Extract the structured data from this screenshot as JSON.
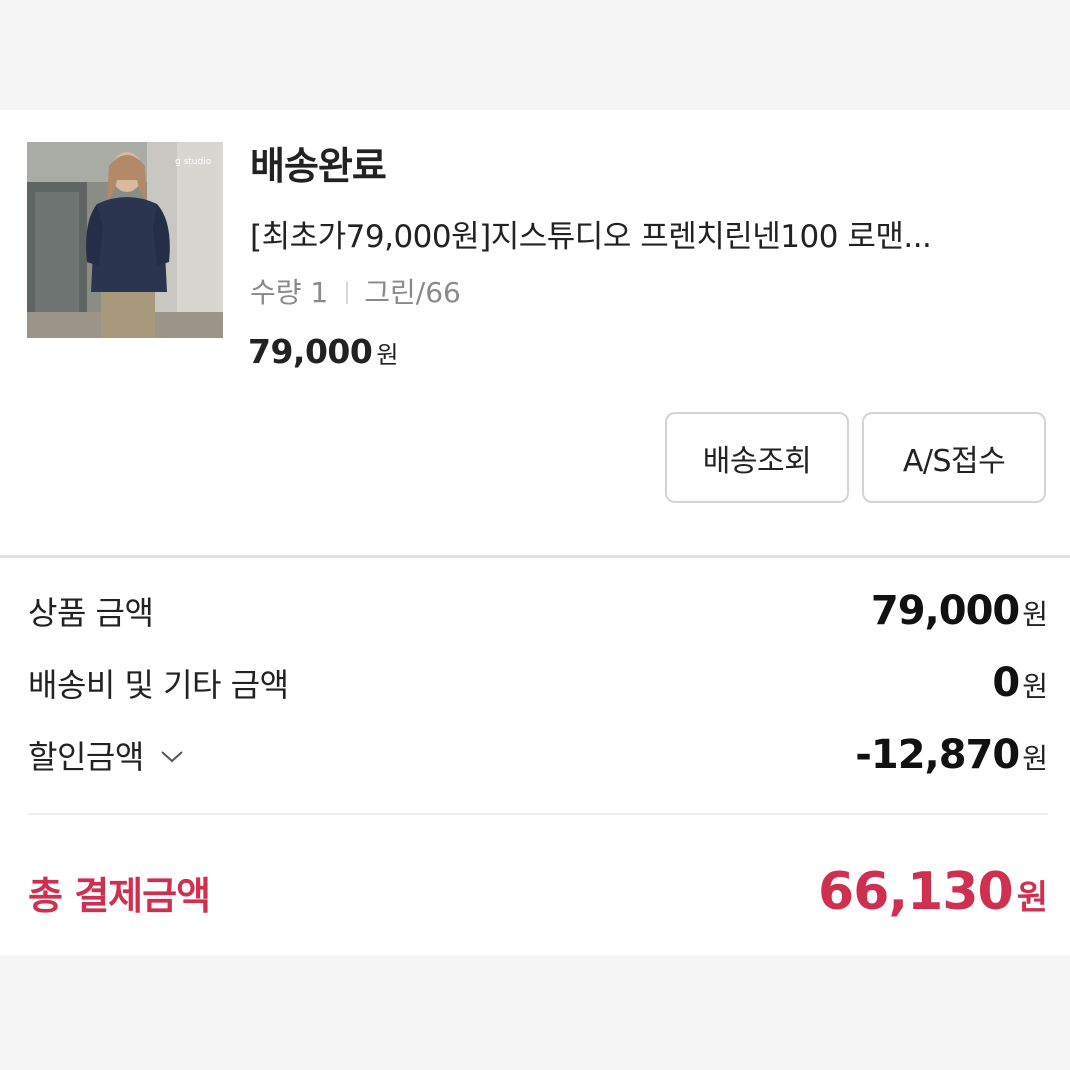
{
  "order": {
    "status": "배송완료",
    "product_title": "[최초가79,000원]지스튜디오 프렌치린넨100 로맨...",
    "quantity_label": "수량 1",
    "option_label": "그린/66",
    "price": "79,000",
    "currency": "원",
    "thumbnail_icon": "product-photo-woman-navy-blouse"
  },
  "actions": {
    "track_label": "배송조회",
    "as_label": "A/S접수"
  },
  "summary": {
    "product_amount_label": "상품 금액",
    "product_amount": "79,000",
    "shipping_label": "배송비 및 기타 금액",
    "shipping_amount": "0",
    "discount_label": "할인금액",
    "discount_amount": "-12,870",
    "currency": "원"
  },
  "total": {
    "label": "총 결제금액",
    "amount": "66,130",
    "currency": "원"
  },
  "colors": {
    "accent": "#d0304f"
  }
}
